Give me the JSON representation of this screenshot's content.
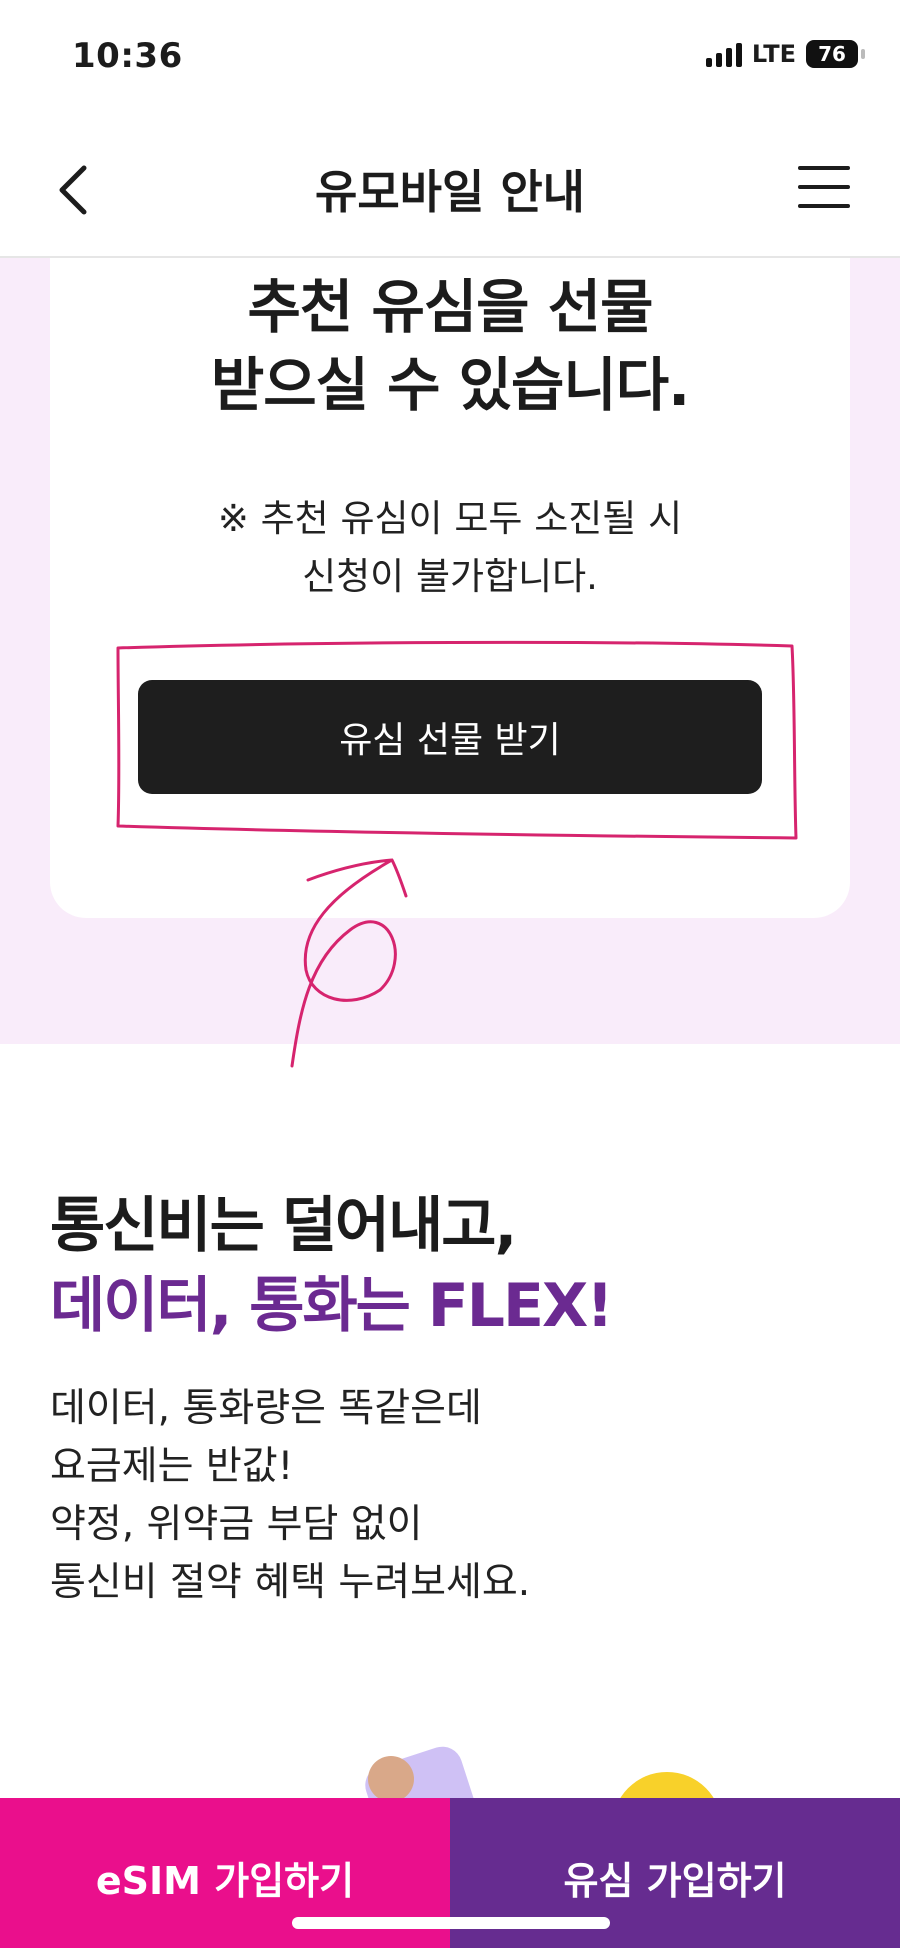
{
  "status_bar": {
    "time": "10:36",
    "network": "LTE",
    "battery": "76"
  },
  "nav": {
    "title": "유모바일 안내",
    "back_icon": "chevron-left-icon",
    "menu_icon": "hamburger-menu-icon"
  },
  "card": {
    "headline_line1": "추천 유심을 선물",
    "headline_line2": "받으실 수 있습니다.",
    "notice_line1": "※ 추천 유심이 모두 소진될 시",
    "notice_line2": "신청이 불가합니다.",
    "button_label": "유심 선물 받기"
  },
  "promo": {
    "title_line1": "통신비는 덜어내고,",
    "title_line2": "데이터, 통화는 FLEX!",
    "body_lines": [
      "데이터, 통화량은 똑같은데",
      "요금제는 반값!",
      "약정, 위약금 부담 없이",
      "통신비 절약 혜택 누려보세요."
    ]
  },
  "bottom_bar": {
    "esim_label": "eSIM 가입하기",
    "usim_label": "유심 가입하기"
  },
  "colors": {
    "accent_pink": "#ea0f8c",
    "accent_purple": "#662c90",
    "section_bg": "#f9ecfa",
    "annotation": "#d6246e"
  }
}
